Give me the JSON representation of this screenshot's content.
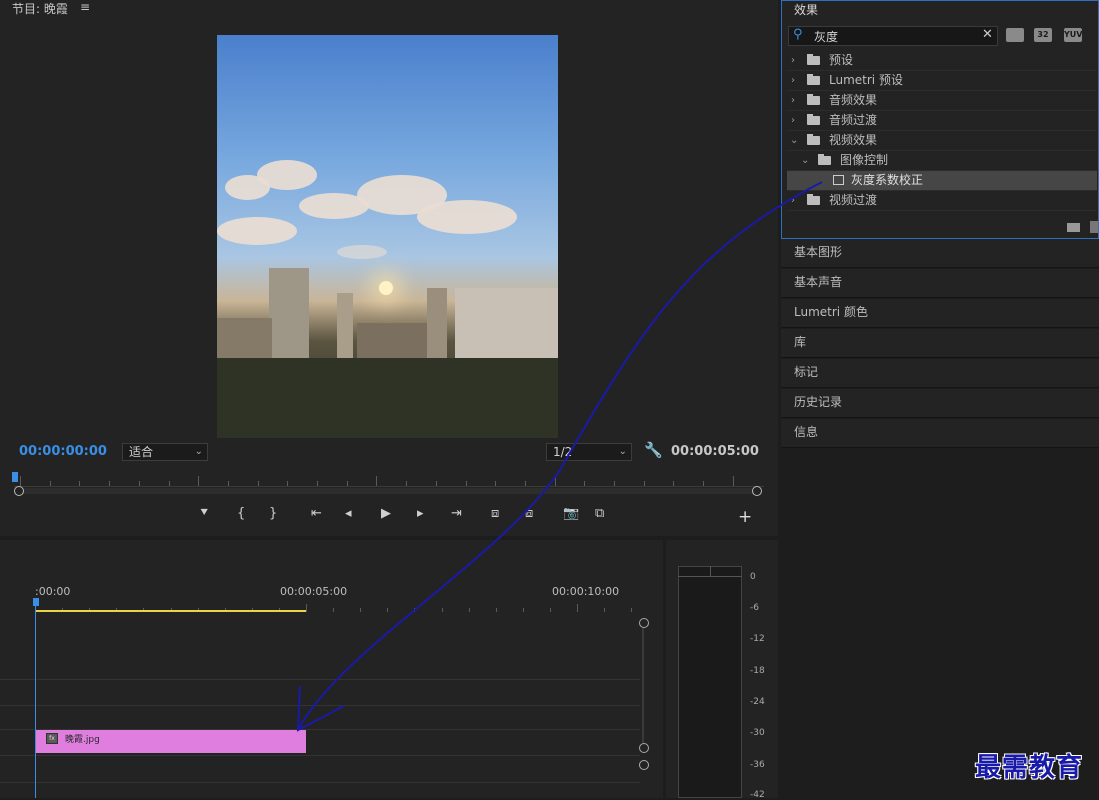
{
  "program_monitor": {
    "title": "节目: 晚霞",
    "menu_icon": "≡",
    "current_timecode": "00:00:00:00",
    "duration_timecode": "00:00:05:00",
    "fit_dropdown": "适合",
    "resolution_dropdown": "1/2"
  },
  "effects_panel": {
    "title": "效果",
    "search_value": "灰度",
    "badges": [
      "",
      "32",
      "YUV"
    ],
    "tree": [
      {
        "label": "预设",
        "expanded": false
      },
      {
        "label": "Lumetri 预设",
        "expanded": false
      },
      {
        "label": "音频效果",
        "expanded": false
      },
      {
        "label": "音频过渡",
        "expanded": false
      },
      {
        "label": "视频效果",
        "expanded": true
      },
      {
        "label": "图像控制",
        "expanded": true
      },
      {
        "label": "灰度系数校正",
        "selected": true
      },
      {
        "label": "视频过渡",
        "expanded": false
      }
    ]
  },
  "side_panels": [
    "基本图形",
    "基本声音",
    "Lumetri 颜色",
    "库",
    "标记",
    "历史记录",
    "信息"
  ],
  "timeline": {
    "time_labels": [
      ":00:00",
      "00:00:05:00",
      "00:00:10:00"
    ],
    "clip_name": "晚霞.jpg",
    "clip_badge": "fx"
  },
  "audio_meter": {
    "db_labels": [
      "0",
      "-6",
      "-12",
      "-18",
      "-24",
      "-30",
      "-36",
      "-42"
    ]
  },
  "watermark": "最需教育",
  "colors": {
    "accent_blue": "#3a8ee6",
    "clip_pink": "#e07ee0",
    "work_area_yellow": "#e8d44a",
    "annotation_arrow": "#1a1aa8"
  }
}
